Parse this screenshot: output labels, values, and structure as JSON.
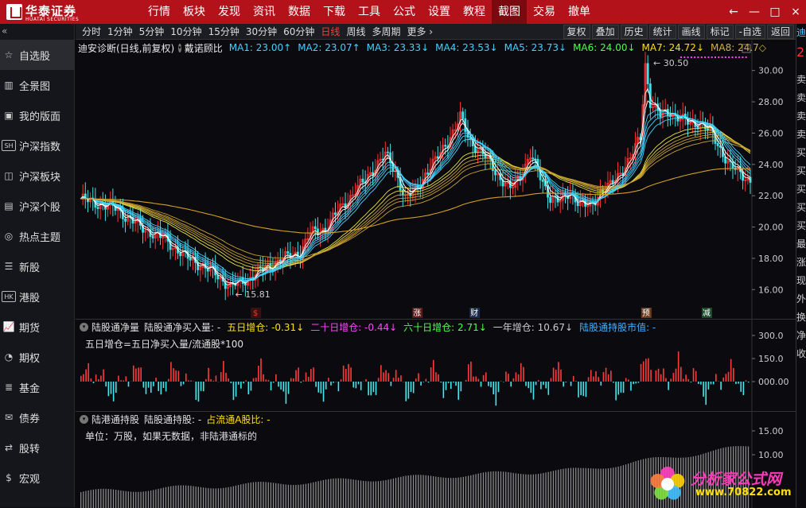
{
  "app": {
    "logo_cn": "华泰证券",
    "logo_en": "HUATAI SECURITIES",
    "brand_color": "#b3121b"
  },
  "nav": [
    "行情",
    "板块",
    "发现",
    "资讯",
    "数据",
    "下载",
    "工具",
    "公式",
    "设置",
    "教程",
    "截图",
    "交易",
    "撤单"
  ],
  "nav_active": "截图",
  "window_controls": [
    "←",
    "—",
    "□",
    "×"
  ],
  "sidebar": {
    "collapse": "«",
    "items": [
      {
        "icon": "star-icon",
        "glyph": "☆",
        "label": "自选股",
        "active": true
      },
      {
        "icon": "panorama-icon",
        "glyph": "▥",
        "label": "全景图"
      },
      {
        "icon": "layout-icon",
        "glyph": "▣",
        "label": "我的版面"
      },
      {
        "icon": "sh-index-icon",
        "glyph": "SH",
        "label": "沪深指数",
        "box": true
      },
      {
        "icon": "sector-icon",
        "glyph": "◫",
        "label": "沪深板块"
      },
      {
        "icon": "stock-icon",
        "glyph": "▤",
        "label": "沪深个股"
      },
      {
        "icon": "hot-topic-icon",
        "glyph": "◎",
        "label": "热点主题"
      },
      {
        "icon": "new-stock-icon",
        "glyph": "☰",
        "label": "新股"
      },
      {
        "icon": "hk-icon",
        "glyph": "HK",
        "label": "港股",
        "box": true
      },
      {
        "icon": "futures-icon",
        "glyph": "📈",
        "label": "期货"
      },
      {
        "icon": "options-icon",
        "glyph": "◔",
        "label": "期权"
      },
      {
        "icon": "fund-icon",
        "glyph": "≣",
        "label": "基金"
      },
      {
        "icon": "bond-icon",
        "glyph": "✉",
        "label": "债券"
      },
      {
        "icon": "convertible-icon",
        "glyph": "⇄",
        "label": "股转"
      },
      {
        "icon": "macro-icon",
        "glyph": "$",
        "label": "宏观"
      }
    ]
  },
  "toolbar": {
    "periods": [
      "分时",
      "1分钟",
      "5分钟",
      "10分钟",
      "15分钟",
      "30分钟",
      "60分钟",
      "日线",
      "周线",
      "多周期",
      "更多 ›"
    ],
    "active_period": "日线",
    "tools": [
      "复权",
      "叠加",
      "历史",
      "统计",
      "画线",
      "标记",
      "-自选",
      "返回"
    ]
  },
  "right_strip": {
    "top_text": "迪",
    "red_text": "2",
    "chars": [
      "卖",
      "卖",
      "卖",
      "卖",
      "买",
      "买",
      "买",
      "买",
      "买",
      "最",
      "涨",
      "现",
      "外",
      "换",
      "净",
      "收"
    ]
  },
  "main_chart": {
    "title": "迪安诊断(日线,前复权)",
    "indicator": "戴诺顾比",
    "ma": [
      {
        "label": "MA1: 23.00↑",
        "color": "#3fd3ff"
      },
      {
        "label": "MA2: 23.07↑",
        "color": "#3fd3ff"
      },
      {
        "label": "MA3: 23.33↓",
        "color": "#3fd3ff"
      },
      {
        "label": "MA4: 23.53↓",
        "color": "#3fd3ff"
      },
      {
        "label": "MA5: 23.73↓",
        "color": "#3fd3ff"
      },
      {
        "label": "MA6: 24.00↓",
        "color": "#4cff4c"
      },
      {
        "label": "MA7: 24.72↓",
        "color": "#ffe000"
      },
      {
        "label": "MA8: 24.7◇",
        "color": "#d4b040"
      }
    ],
    "y_ticks": [
      "30.00",
      "28.00",
      "26.00",
      "24.00",
      "22.00",
      "20.00",
      "18.00",
      "16.00"
    ],
    "y_range": [
      15.0,
      31.0
    ],
    "high_label": "30.50",
    "low_label": "15.81",
    "event_markers": [
      {
        "label": "$",
        "color": "#ff3030",
        "bg": "#3a1010",
        "pos": 0.265
      },
      {
        "label": "涨",
        "color": "#ffffff",
        "bg": "#5a1a1a",
        "pos": 0.505
      },
      {
        "label": "财",
        "color": "#ffffff",
        "bg": "#1a2a4a",
        "pos": 0.59
      },
      {
        "label": "预",
        "color": "#ffffff",
        "bg": "#6a3a1a",
        "pos": 0.845
      },
      {
        "label": "减",
        "color": "#ffffff",
        "bg": "#1a4a2a",
        "pos": 0.935
      }
    ]
  },
  "sub1": {
    "name": "陆股通净量",
    "field": "陆股通净买入量: -",
    "items": [
      {
        "label": "五日增仓: -0.31↓",
        "color": "#ffe000"
      },
      {
        "label": "二十日增仓: -0.44↓",
        "color": "#ff44ff"
      },
      {
        "label": "六十日增仓: 2.71↓",
        "color": "#4cff4c"
      },
      {
        "label": "一年增仓: 10.67↓",
        "color": "#cccccc"
      },
      {
        "label": "陆股通持股市值: -",
        "color": "#3fb0ff"
      }
    ],
    "formula": "五日增仓=五日净买入量/流通股*100",
    "y_ticks": [
      "300.0",
      "150.0",
      "000.00"
    ]
  },
  "sub2": {
    "name": "陆港通持股",
    "field": "陆股通持股: -",
    "extra": "占流通A股比: -",
    "formula": "单位：万股，如果无数据，非陆港通标的",
    "y_ticks": [
      "15.00",
      "10.00"
    ]
  },
  "watermark": {
    "text": "分析家公式网",
    "url": "www.70822.com"
  }
}
